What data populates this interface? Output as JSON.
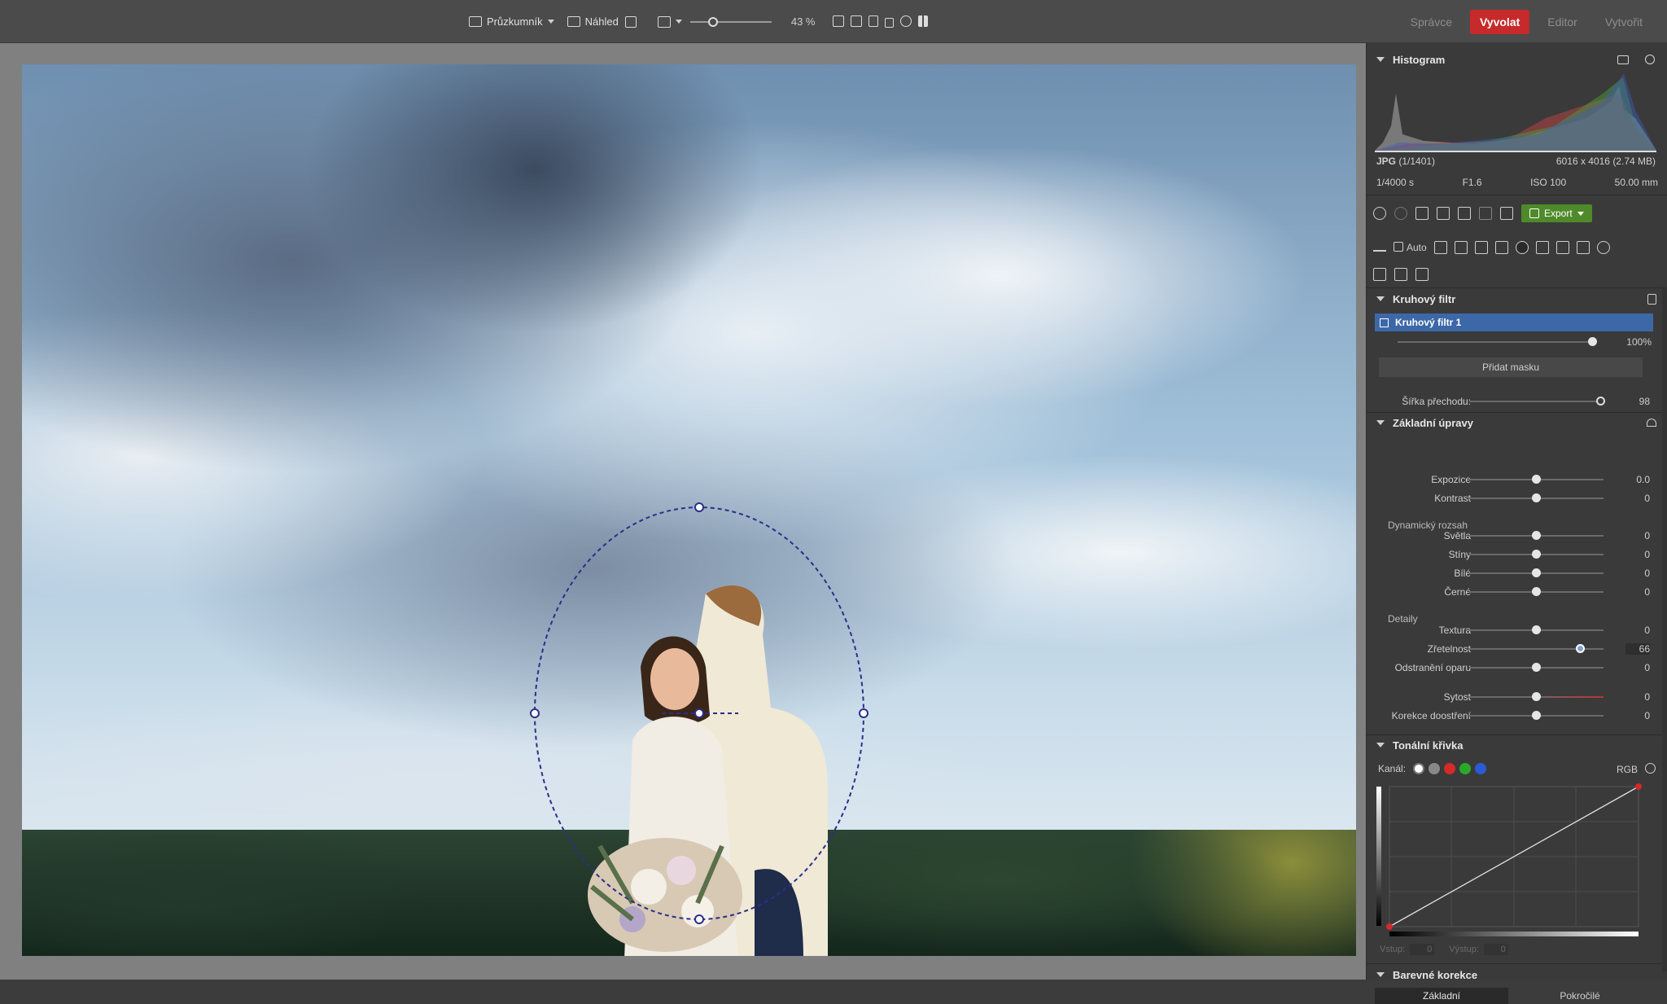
{
  "toolbar": {
    "explorer": "Průzkumník",
    "preview": "Náhled",
    "zoom": "43 %"
  },
  "modes": [
    {
      "label": "Správce"
    },
    {
      "label": "Vyvolat"
    },
    {
      "label": "Editor"
    },
    {
      "label": "Vytvořit"
    }
  ],
  "histogram": {
    "title": "Histogram",
    "format": "JPG",
    "index": "(1/1401)",
    "dimensions": "6016 x 4016 (2.74 MB)",
    "shutter": "1/4000 s",
    "aperture": "F1.6",
    "iso": "ISO 100",
    "focal": "50.00 mm"
  },
  "actions": {
    "export": "Export"
  },
  "tools": {
    "auto": "Auto"
  },
  "radial": {
    "title": "Kruhový filtr",
    "item": "Kruhový filtr 1",
    "opacity": "100%",
    "opacity_level": 1.0,
    "add_mask": "Přidat masku",
    "feather_label": "Šířka přechodu:",
    "feather_value": "98",
    "feather_level": 0.98
  },
  "basic": {
    "title": "Základní úpravy",
    "dynamic": "Dynamický rozsah",
    "details": "Detaily",
    "rows": [
      {
        "label": "Expozice",
        "value": "0.0",
        "level": 0.5
      },
      {
        "label": "Kontrast",
        "value": "0",
        "level": 0.5
      },
      {
        "label": "Světla",
        "value": "0",
        "level": 0.5
      },
      {
        "label": "Stíny",
        "value": "0",
        "level": 0.5
      },
      {
        "label": "Bílé",
        "value": "0",
        "level": 0.5
      },
      {
        "label": "Černé",
        "value": "0",
        "level": 0.5
      },
      {
        "label": "Textura",
        "value": "0",
        "level": 0.5
      },
      {
        "label": "Zřetelnost",
        "value": "66",
        "level": 0.83
      },
      {
        "label": "Odstranění oparu",
        "value": "0",
        "level": 0.5
      },
      {
        "label": "Sytost",
        "value": "0",
        "level": 0.5
      },
      {
        "label": "Korekce doostření",
        "value": "0",
        "level": 0.5
      }
    ]
  },
  "curve": {
    "title": "Tonální křivka",
    "channel_label": "Kanál:",
    "channel": "RGB",
    "input_label": "Vstup:",
    "input_value": "0",
    "output_label": "Výstup:",
    "output_value": "0"
  },
  "color": {
    "title": "Barevné korekce",
    "tab_basic": "Základní",
    "tab_advanced": "Pokročilé"
  },
  "colors": {
    "accent_red": "#c62a2a",
    "selection_blue": "#3c68a8",
    "export_green": "#4f8a2a"
  }
}
